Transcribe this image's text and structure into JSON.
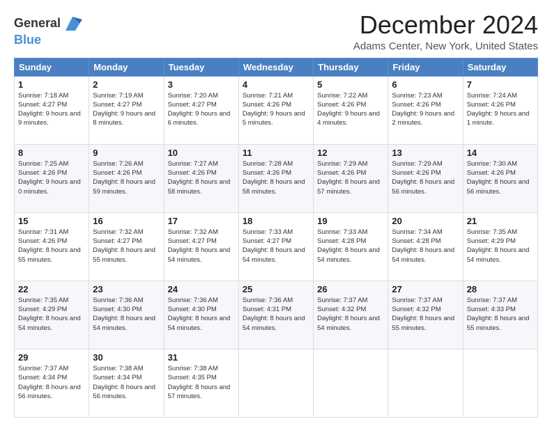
{
  "header": {
    "logo_line1": "General",
    "logo_line2": "Blue",
    "title": "December 2024",
    "subtitle": "Adams Center, New York, United States"
  },
  "weekdays": [
    "Sunday",
    "Monday",
    "Tuesday",
    "Wednesday",
    "Thursday",
    "Friday",
    "Saturday"
  ],
  "weeks": [
    [
      {
        "day": "1",
        "info": "Sunrise: 7:18 AM\nSunset: 4:27 PM\nDaylight: 9 hours and 9 minutes."
      },
      {
        "day": "2",
        "info": "Sunrise: 7:19 AM\nSunset: 4:27 PM\nDaylight: 9 hours and 8 minutes."
      },
      {
        "day": "3",
        "info": "Sunrise: 7:20 AM\nSunset: 4:27 PM\nDaylight: 9 hours and 6 minutes."
      },
      {
        "day": "4",
        "info": "Sunrise: 7:21 AM\nSunset: 4:26 PM\nDaylight: 9 hours and 5 minutes."
      },
      {
        "day": "5",
        "info": "Sunrise: 7:22 AM\nSunset: 4:26 PM\nDaylight: 9 hours and 4 minutes."
      },
      {
        "day": "6",
        "info": "Sunrise: 7:23 AM\nSunset: 4:26 PM\nDaylight: 9 hours and 2 minutes."
      },
      {
        "day": "7",
        "info": "Sunrise: 7:24 AM\nSunset: 4:26 PM\nDaylight: 9 hours and 1 minute."
      }
    ],
    [
      {
        "day": "8",
        "info": "Sunrise: 7:25 AM\nSunset: 4:26 PM\nDaylight: 9 hours and 0 minutes."
      },
      {
        "day": "9",
        "info": "Sunrise: 7:26 AM\nSunset: 4:26 PM\nDaylight: 8 hours and 59 minutes."
      },
      {
        "day": "10",
        "info": "Sunrise: 7:27 AM\nSunset: 4:26 PM\nDaylight: 8 hours and 58 minutes."
      },
      {
        "day": "11",
        "info": "Sunrise: 7:28 AM\nSunset: 4:26 PM\nDaylight: 8 hours and 58 minutes."
      },
      {
        "day": "12",
        "info": "Sunrise: 7:29 AM\nSunset: 4:26 PM\nDaylight: 8 hours and 57 minutes."
      },
      {
        "day": "13",
        "info": "Sunrise: 7:29 AM\nSunset: 4:26 PM\nDaylight: 8 hours and 56 minutes."
      },
      {
        "day": "14",
        "info": "Sunrise: 7:30 AM\nSunset: 4:26 PM\nDaylight: 8 hours and 56 minutes."
      }
    ],
    [
      {
        "day": "15",
        "info": "Sunrise: 7:31 AM\nSunset: 4:26 PM\nDaylight: 8 hours and 55 minutes."
      },
      {
        "day": "16",
        "info": "Sunrise: 7:32 AM\nSunset: 4:27 PM\nDaylight: 8 hours and 55 minutes."
      },
      {
        "day": "17",
        "info": "Sunrise: 7:32 AM\nSunset: 4:27 PM\nDaylight: 8 hours and 54 minutes."
      },
      {
        "day": "18",
        "info": "Sunrise: 7:33 AM\nSunset: 4:27 PM\nDaylight: 8 hours and 54 minutes."
      },
      {
        "day": "19",
        "info": "Sunrise: 7:33 AM\nSunset: 4:28 PM\nDaylight: 8 hours and 54 minutes."
      },
      {
        "day": "20",
        "info": "Sunrise: 7:34 AM\nSunset: 4:28 PM\nDaylight: 8 hours and 54 minutes."
      },
      {
        "day": "21",
        "info": "Sunrise: 7:35 AM\nSunset: 4:29 PM\nDaylight: 8 hours and 54 minutes."
      }
    ],
    [
      {
        "day": "22",
        "info": "Sunrise: 7:35 AM\nSunset: 4:29 PM\nDaylight: 8 hours and 54 minutes."
      },
      {
        "day": "23",
        "info": "Sunrise: 7:36 AM\nSunset: 4:30 PM\nDaylight: 8 hours and 54 minutes."
      },
      {
        "day": "24",
        "info": "Sunrise: 7:36 AM\nSunset: 4:30 PM\nDaylight: 8 hours and 54 minutes."
      },
      {
        "day": "25",
        "info": "Sunrise: 7:36 AM\nSunset: 4:31 PM\nDaylight: 8 hours and 54 minutes."
      },
      {
        "day": "26",
        "info": "Sunrise: 7:37 AM\nSunset: 4:32 PM\nDaylight: 8 hours and 54 minutes."
      },
      {
        "day": "27",
        "info": "Sunrise: 7:37 AM\nSunset: 4:32 PM\nDaylight: 8 hours and 55 minutes."
      },
      {
        "day": "28",
        "info": "Sunrise: 7:37 AM\nSunset: 4:33 PM\nDaylight: 8 hours and 55 minutes."
      }
    ],
    [
      {
        "day": "29",
        "info": "Sunrise: 7:37 AM\nSunset: 4:34 PM\nDaylight: 8 hours and 56 minutes."
      },
      {
        "day": "30",
        "info": "Sunrise: 7:38 AM\nSunset: 4:34 PM\nDaylight: 8 hours and 56 minutes."
      },
      {
        "day": "31",
        "info": "Sunrise: 7:38 AM\nSunset: 4:35 PM\nDaylight: 8 hours and 57 minutes."
      },
      null,
      null,
      null,
      null
    ]
  ]
}
